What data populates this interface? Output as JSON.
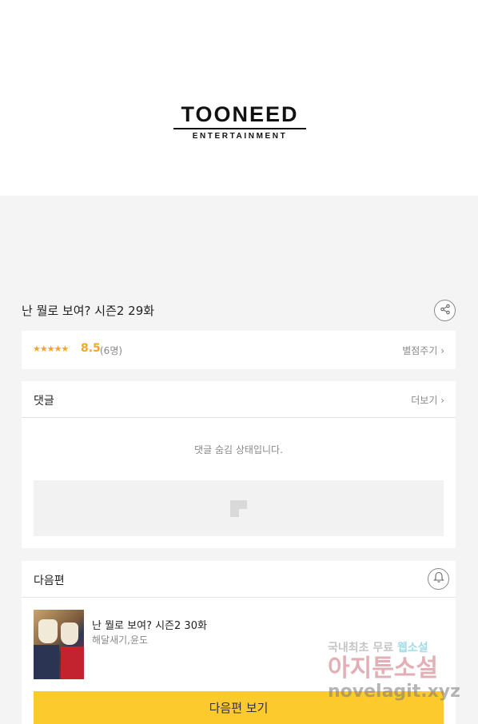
{
  "logo": {
    "main": "TOONEED",
    "sub": "ENTERTAINMENT"
  },
  "episode": {
    "title": "난 뭘로 보여? 시즌2 29화"
  },
  "rating": {
    "stars": "★★★★★",
    "score": "8.5",
    "count": "(6명)",
    "rate_label": "별점주기 ›"
  },
  "comments": {
    "header": "댓글",
    "more_label": "더보기 ›",
    "hidden_message": "댓글 숨김 상태입니다."
  },
  "next": {
    "header": "다음편",
    "episode_title": "난 뭘로 보여? 시즌2 30화",
    "authors": "해달새기,윤도",
    "button_label": "다음편 보기"
  },
  "watermark": {
    "line1_a": "국내최초 무료 ",
    "line1_b": "웹소설",
    "line2": "아지툰소설",
    "line3": "novelagit.xyz"
  },
  "colors": {
    "accent": "#fdca2d",
    "star": "#f5a623",
    "background": "#f4f4f4"
  }
}
